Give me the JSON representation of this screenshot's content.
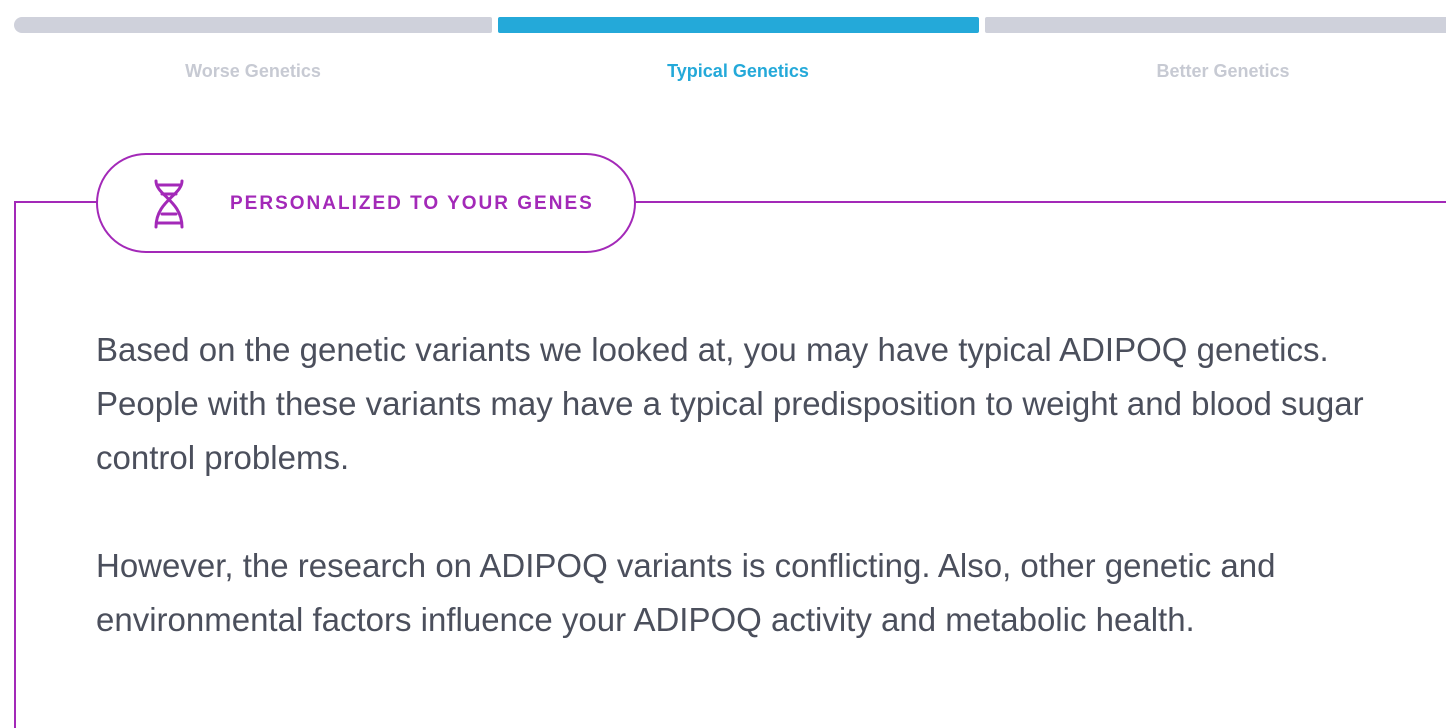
{
  "genetics_scale": {
    "segments": [
      {
        "label": "Worse Genetics",
        "active": false
      },
      {
        "label": "Typical Genetics",
        "active": true
      },
      {
        "label": "Better Genetics",
        "active": false
      }
    ],
    "active_color": "#24a9d9",
    "inactive_color": "#cfd1db"
  },
  "personalized_badge": {
    "icon": "dna-icon",
    "label": "PERSONALIZED TO YOUR GENES",
    "color": "#a329b8"
  },
  "content": {
    "paragraphs": [
      "Based on the genetic variants we looked at, you may have typical ADIPOQ genetics. People with these variants may have a typical predisposition to weight and blood sugar control problems.",
      "However, the research on ADIPOQ variants is conflicting. Also, other genetic and environmental factors influence your ADIPOQ activity and metabolic health."
    ],
    "text_color": "#4b4f5c"
  }
}
